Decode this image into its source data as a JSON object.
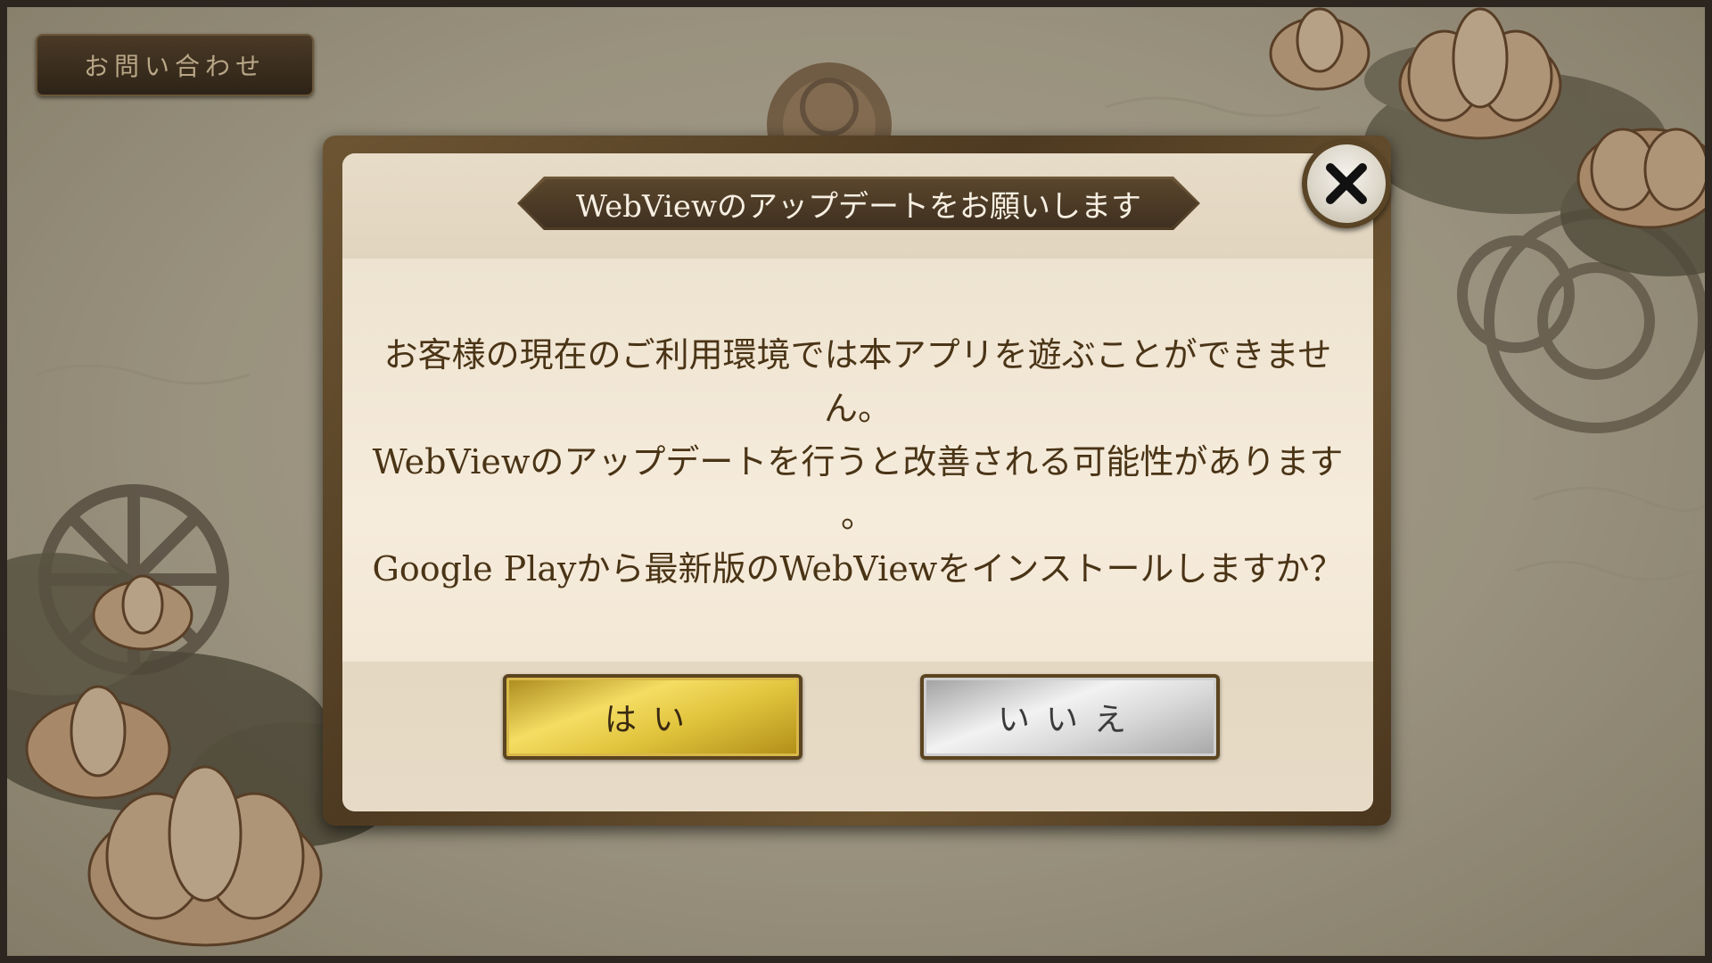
{
  "topbar": {
    "contact_label": "お問い合わせ"
  },
  "dialog": {
    "title": "WebViewのアップデートをお願いします",
    "message_lines": [
      "お客様の現在のご利用環境では本アプリを遊ぶことができませ",
      "ん。",
      "WebViewのアップデートを行うと改善される可能性があります",
      "。",
      "Google Playから最新版のWebViewをインストールしますか？"
    ],
    "yes_label": "はい",
    "no_label": "いいえ",
    "close_icon": "close-x-icon"
  },
  "colors": {
    "dialog_frame": "#5a4426",
    "dialog_panel": "#f2e7d6",
    "text_brown": "#4a3416",
    "yes_gold": "#e1c43d",
    "no_silver": "#dadada"
  }
}
